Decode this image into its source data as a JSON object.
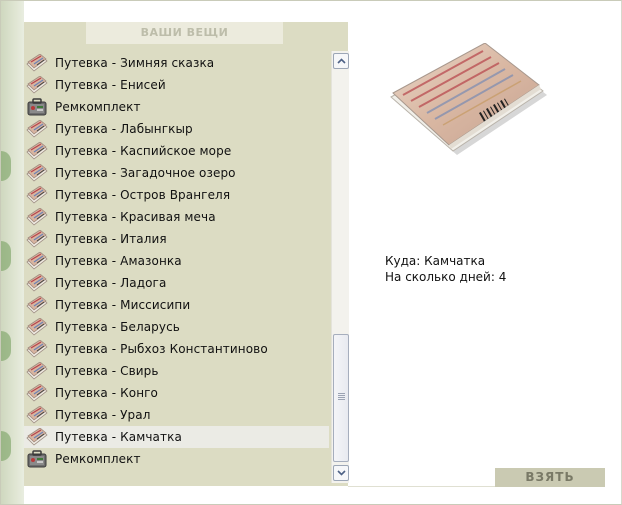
{
  "panel": {
    "title": "ВАШИ ВЕЩИ"
  },
  "inventory": {
    "items": [
      {
        "label": "Путевка - Зимняя сказка",
        "icon": "ticket-icon",
        "selected": false
      },
      {
        "label": "Путевка - Енисей",
        "icon": "ticket-icon",
        "selected": false
      },
      {
        "label": "Ремкомплект",
        "icon": "repair-kit-icon",
        "selected": false
      },
      {
        "label": "Путевка - Лабынгкыр",
        "icon": "ticket-icon",
        "selected": false
      },
      {
        "label": "Путевка - Каспийское море",
        "icon": "ticket-icon",
        "selected": false
      },
      {
        "label": "Путевка - Загадочное озеро",
        "icon": "ticket-icon",
        "selected": false
      },
      {
        "label": "Путевка - Остров Врангеля",
        "icon": "ticket-icon",
        "selected": false
      },
      {
        "label": "Путевка - Красивая меча",
        "icon": "ticket-icon",
        "selected": false
      },
      {
        "label": "Путевка - Италия",
        "icon": "ticket-icon",
        "selected": false
      },
      {
        "label": "Путевка - Амазонка",
        "icon": "ticket-icon",
        "selected": false
      },
      {
        "label": "Путевка - Ладога",
        "icon": "ticket-icon",
        "selected": false
      },
      {
        "label": "Путевка - Миссисипи",
        "icon": "ticket-icon",
        "selected": false
      },
      {
        "label": "Путевка - Беларусь",
        "icon": "ticket-icon",
        "selected": false
      },
      {
        "label": "Путевка - Рыбхоз Константиново",
        "icon": "ticket-icon",
        "selected": false
      },
      {
        "label": "Путевка - Свирь",
        "icon": "ticket-icon",
        "selected": false
      },
      {
        "label": "Путевка - Конго",
        "icon": "ticket-icon",
        "selected": false
      },
      {
        "label": "Путевка - Урал",
        "icon": "ticket-icon",
        "selected": false
      },
      {
        "label": "Путевка - Камчатка",
        "icon": "ticket-icon",
        "selected": true
      },
      {
        "label": "Ремкомплект",
        "icon": "repair-kit-icon",
        "selected": false
      }
    ]
  },
  "details": {
    "destination_label": "Куда:",
    "destination_value": "Камчатка",
    "days_label": "На сколько дней:",
    "days_value": "4"
  },
  "actions": {
    "take_label": "ВЗЯТЬ"
  },
  "colors": {
    "panel_bg": "#dcdcc3",
    "selected_row": "#ebebe5",
    "button_bg": "#cacab2",
    "button_text": "#797966",
    "header_text": "#bdbdaa"
  }
}
